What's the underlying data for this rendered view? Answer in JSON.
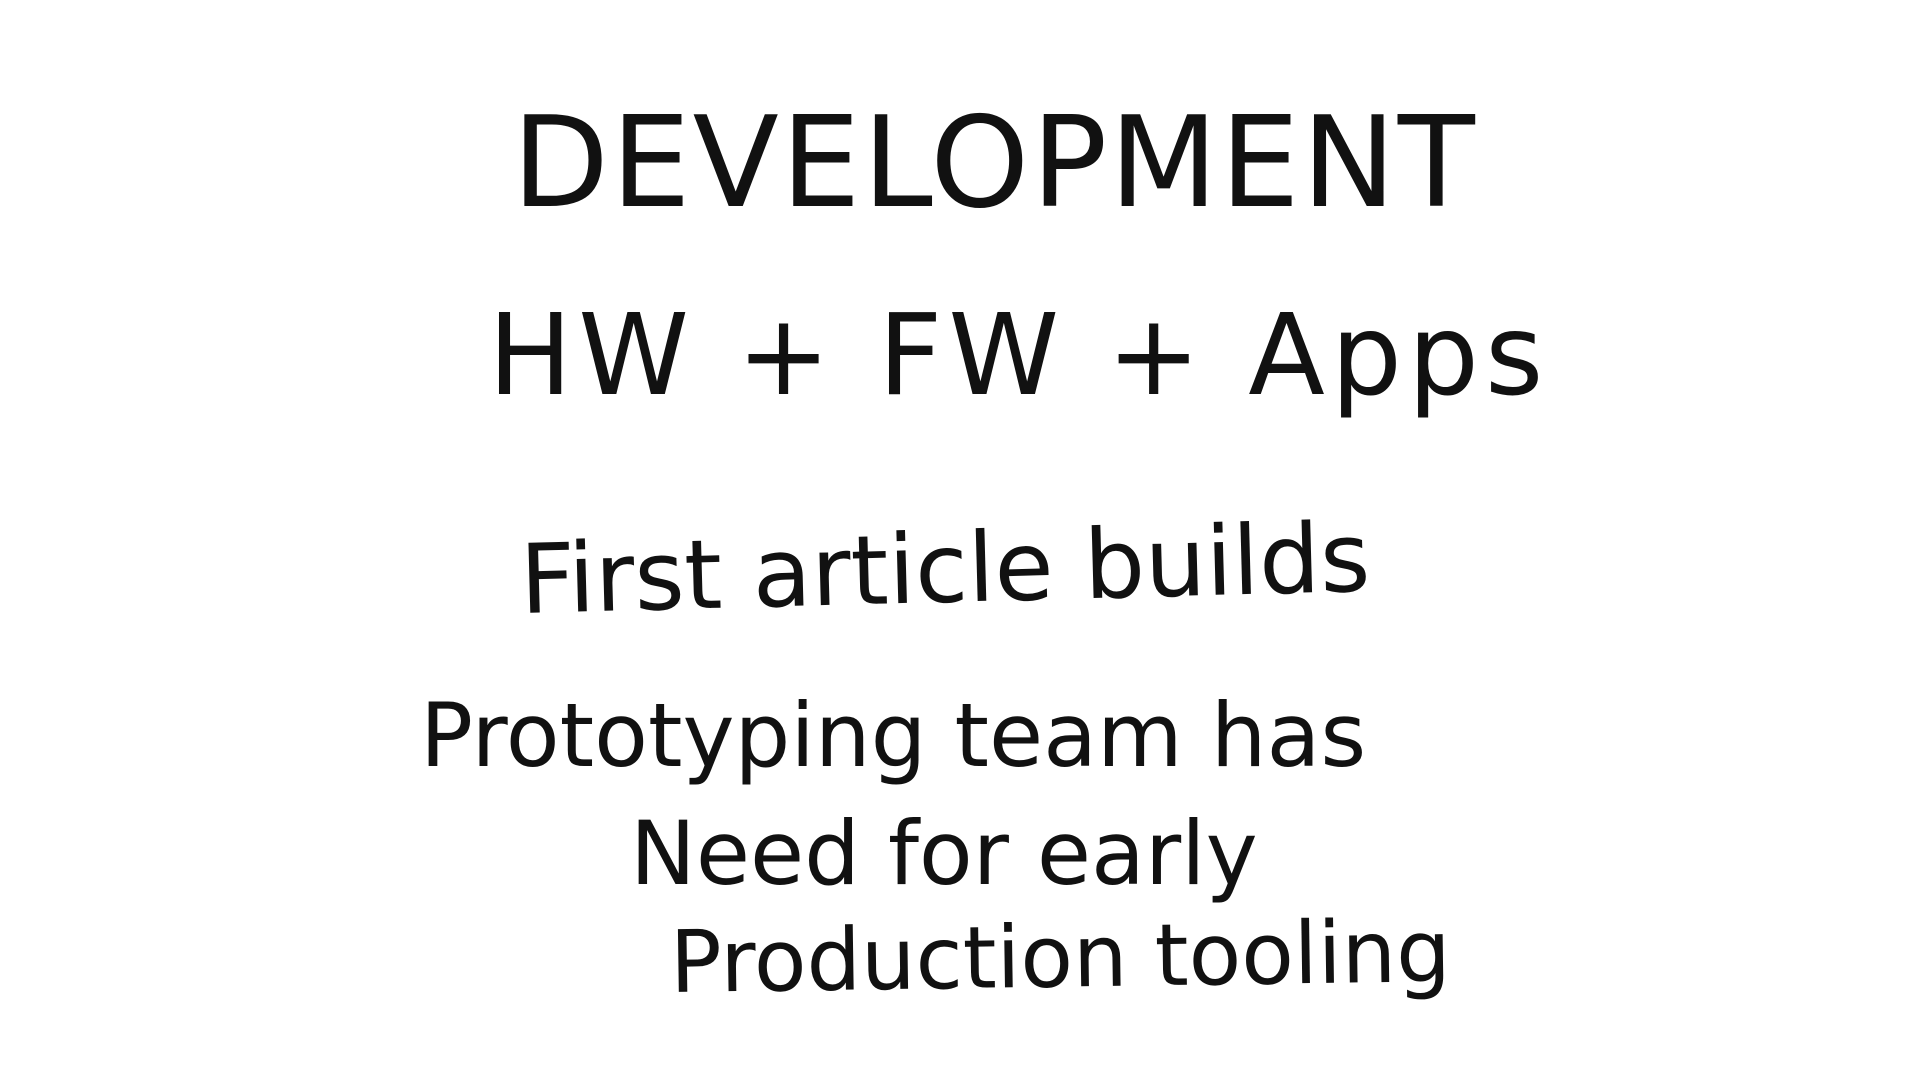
{
  "slide": {
    "title": "DEVELOPMENT",
    "lines": [
      "HW + FW + Apps",
      "First article builds",
      "Prototyping team has",
      "Need for early",
      "Production tooling"
    ]
  }
}
